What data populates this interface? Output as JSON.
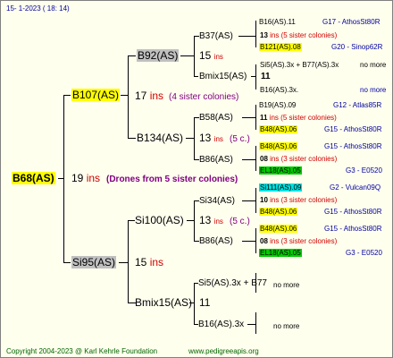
{
  "header": {
    "date_line": "15-   1-2023  ( 18:  14)"
  },
  "colors": {
    "yellow": "#ffff00",
    "grey": "#c0c0c0",
    "green": "#00cc00",
    "cyan": "#00e0e0"
  },
  "root": {
    "name": "B68(AS)",
    "count": "19",
    "unit": "ins",
    "note": "(Drones from 5 sister colonies)"
  },
  "gen1": [
    {
      "name": "B107(AS)",
      "count": "17",
      "unit": "ins",
      "note": "(4 sister colonies)"
    },
    {
      "name": "Si95(AS)",
      "count": "15",
      "unit": "ins"
    }
  ],
  "gen2": [
    {
      "name": "B92(AS)",
      "count": "15",
      "unit": "ins"
    },
    {
      "name": "B134(AS)",
      "count": "13",
      "unit": "ins",
      "note": "(5 c.)"
    },
    {
      "name": "Si100(AS)",
      "count": "13",
      "unit": "ins",
      "note": "(5 c.)"
    },
    {
      "name": "Bmix15(AS)",
      "count": "11"
    }
  ],
  "gen3": [
    {
      "name": "B37(AS)",
      "count": "15",
      "unit": "ins"
    },
    {
      "name": "Bmix15(AS)",
      "count": "11"
    },
    {
      "name": "B58(AS)",
      "count": "11",
      "unit": "ins"
    },
    {
      "name": "B86(AS)",
      "count": "08",
      "unit": "ins"
    },
    {
      "name": "Si34(AS)",
      "count": "10",
      "unit": "ins"
    },
    {
      "name": "B86(AS)",
      "count": "08",
      "unit": "ins"
    },
    {
      "name": "Si5(AS).3x + B77",
      "note": "no more"
    },
    {
      "name": "B16(AS).3x",
      "note": "no more"
    }
  ],
  "gen4": [
    {
      "name": "B16(AS).11",
      "info": "G17 - AthosSt80R"
    },
    {
      "name": "13",
      "note": "ins (5 sister colonies)"
    },
    {
      "name": "B121(AS).08",
      "info": "G20 - Sinop62R"
    },
    {
      "name": "Si5(AS).3x + B77(AS).3x",
      "note": "no more"
    },
    {
      "name": "11"
    },
    {
      "name": "B16(AS).3x.",
      "note": "no more"
    },
    {
      "name": "B19(AS).09",
      "info": "G12 - Atlas85R"
    },
    {
      "name": "11",
      "note": "ins (5 sister colonies)"
    },
    {
      "name": "B48(AS).06",
      "info": "G15 - AthosSt80R"
    },
    {
      "name": "B48(AS).06",
      "info": "G15 - AthosSt80R"
    },
    {
      "name": "08",
      "note": "ins (3 sister colonies)"
    },
    {
      "name": "EL18(AS).05",
      "info": "G3 - E0520"
    },
    {
      "name": "Si111(AS).09",
      "info": "G2 - Vulcan09Q"
    },
    {
      "name": "10",
      "note": "ins (3 sister colonies)"
    },
    {
      "name": "B48(AS).06",
      "info": "G15 - AthosSt80R"
    },
    {
      "name": "B48(AS).06",
      "info": "G15 - AthosSt80R"
    },
    {
      "name": "08",
      "note": "ins (3 sister colonies)"
    },
    {
      "name": "EL18(AS).05",
      "info": "G3 - E0520"
    }
  ],
  "footer": {
    "copyright": "Copyright 2004-2023 @ Karl Kehrle Foundation",
    "url": "www.pedigreeapis.org"
  }
}
